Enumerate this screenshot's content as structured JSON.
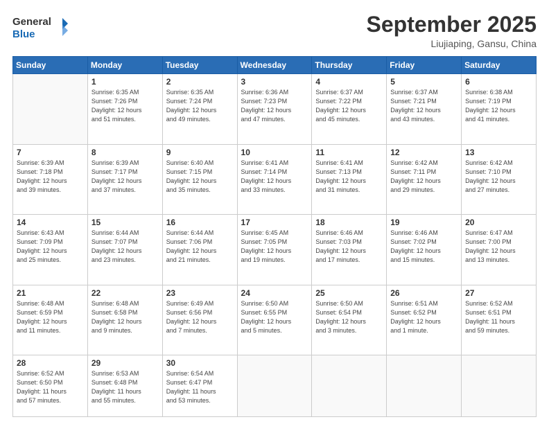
{
  "header": {
    "logo": {
      "line1": "General",
      "line2": "Blue"
    },
    "title": "September 2025",
    "location": "Liujiaping, Gansu, China"
  },
  "days_of_week": [
    "Sunday",
    "Monday",
    "Tuesday",
    "Wednesday",
    "Thursday",
    "Friday",
    "Saturday"
  ],
  "weeks": [
    [
      {
        "day": "",
        "info": ""
      },
      {
        "day": "1",
        "info": "Sunrise: 6:35 AM\nSunset: 7:26 PM\nDaylight: 12 hours\nand 51 minutes."
      },
      {
        "day": "2",
        "info": "Sunrise: 6:35 AM\nSunset: 7:24 PM\nDaylight: 12 hours\nand 49 minutes."
      },
      {
        "day": "3",
        "info": "Sunrise: 6:36 AM\nSunset: 7:23 PM\nDaylight: 12 hours\nand 47 minutes."
      },
      {
        "day": "4",
        "info": "Sunrise: 6:37 AM\nSunset: 7:22 PM\nDaylight: 12 hours\nand 45 minutes."
      },
      {
        "day": "5",
        "info": "Sunrise: 6:37 AM\nSunset: 7:21 PM\nDaylight: 12 hours\nand 43 minutes."
      },
      {
        "day": "6",
        "info": "Sunrise: 6:38 AM\nSunset: 7:19 PM\nDaylight: 12 hours\nand 41 minutes."
      }
    ],
    [
      {
        "day": "7",
        "info": "Sunrise: 6:39 AM\nSunset: 7:18 PM\nDaylight: 12 hours\nand 39 minutes."
      },
      {
        "day": "8",
        "info": "Sunrise: 6:39 AM\nSunset: 7:17 PM\nDaylight: 12 hours\nand 37 minutes."
      },
      {
        "day": "9",
        "info": "Sunrise: 6:40 AM\nSunset: 7:15 PM\nDaylight: 12 hours\nand 35 minutes."
      },
      {
        "day": "10",
        "info": "Sunrise: 6:41 AM\nSunset: 7:14 PM\nDaylight: 12 hours\nand 33 minutes."
      },
      {
        "day": "11",
        "info": "Sunrise: 6:41 AM\nSunset: 7:13 PM\nDaylight: 12 hours\nand 31 minutes."
      },
      {
        "day": "12",
        "info": "Sunrise: 6:42 AM\nSunset: 7:11 PM\nDaylight: 12 hours\nand 29 minutes."
      },
      {
        "day": "13",
        "info": "Sunrise: 6:42 AM\nSunset: 7:10 PM\nDaylight: 12 hours\nand 27 minutes."
      }
    ],
    [
      {
        "day": "14",
        "info": "Sunrise: 6:43 AM\nSunset: 7:09 PM\nDaylight: 12 hours\nand 25 minutes."
      },
      {
        "day": "15",
        "info": "Sunrise: 6:44 AM\nSunset: 7:07 PM\nDaylight: 12 hours\nand 23 minutes."
      },
      {
        "day": "16",
        "info": "Sunrise: 6:44 AM\nSunset: 7:06 PM\nDaylight: 12 hours\nand 21 minutes."
      },
      {
        "day": "17",
        "info": "Sunrise: 6:45 AM\nSunset: 7:05 PM\nDaylight: 12 hours\nand 19 minutes."
      },
      {
        "day": "18",
        "info": "Sunrise: 6:46 AM\nSunset: 7:03 PM\nDaylight: 12 hours\nand 17 minutes."
      },
      {
        "day": "19",
        "info": "Sunrise: 6:46 AM\nSunset: 7:02 PM\nDaylight: 12 hours\nand 15 minutes."
      },
      {
        "day": "20",
        "info": "Sunrise: 6:47 AM\nSunset: 7:00 PM\nDaylight: 12 hours\nand 13 minutes."
      }
    ],
    [
      {
        "day": "21",
        "info": "Sunrise: 6:48 AM\nSunset: 6:59 PM\nDaylight: 12 hours\nand 11 minutes."
      },
      {
        "day": "22",
        "info": "Sunrise: 6:48 AM\nSunset: 6:58 PM\nDaylight: 12 hours\nand 9 minutes."
      },
      {
        "day": "23",
        "info": "Sunrise: 6:49 AM\nSunset: 6:56 PM\nDaylight: 12 hours\nand 7 minutes."
      },
      {
        "day": "24",
        "info": "Sunrise: 6:50 AM\nSunset: 6:55 PM\nDaylight: 12 hours\nand 5 minutes."
      },
      {
        "day": "25",
        "info": "Sunrise: 6:50 AM\nSunset: 6:54 PM\nDaylight: 12 hours\nand 3 minutes."
      },
      {
        "day": "26",
        "info": "Sunrise: 6:51 AM\nSunset: 6:52 PM\nDaylight: 12 hours\nand 1 minute."
      },
      {
        "day": "27",
        "info": "Sunrise: 6:52 AM\nSunset: 6:51 PM\nDaylight: 11 hours\nand 59 minutes."
      }
    ],
    [
      {
        "day": "28",
        "info": "Sunrise: 6:52 AM\nSunset: 6:50 PM\nDaylight: 11 hours\nand 57 minutes."
      },
      {
        "day": "29",
        "info": "Sunrise: 6:53 AM\nSunset: 6:48 PM\nDaylight: 11 hours\nand 55 minutes."
      },
      {
        "day": "30",
        "info": "Sunrise: 6:54 AM\nSunset: 6:47 PM\nDaylight: 11 hours\nand 53 minutes."
      },
      {
        "day": "",
        "info": ""
      },
      {
        "day": "",
        "info": ""
      },
      {
        "day": "",
        "info": ""
      },
      {
        "day": "",
        "info": ""
      }
    ]
  ]
}
